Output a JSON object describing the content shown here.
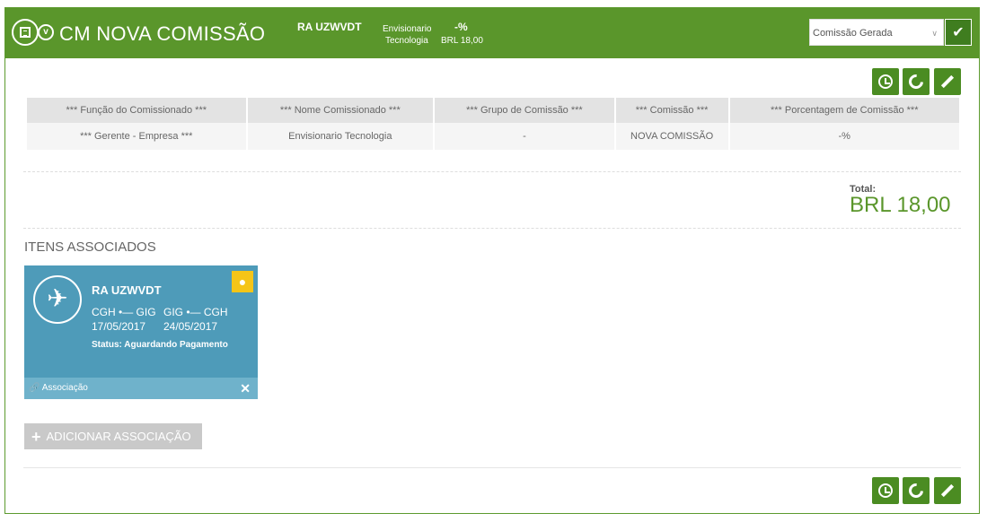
{
  "header": {
    "title": "CM NOVA COMISSÃO",
    "code": "RA UZWVDT",
    "name_line1": "Envisionario",
    "name_line2": "Tecnologia",
    "percent": "-%",
    "amount": "BRL 18,00",
    "status_selected": "Comissão Gerada",
    "colors": {
      "header_bg": "#5a962b",
      "button_bg": "#4b8c22"
    }
  },
  "table": {
    "headers": [
      "*** Função do Comissionado ***",
      "*** Nome Comissionado ***",
      "*** Grupo de Comissão ***",
      "*** Comissão ***",
      "*** Porcentagem de Comissão ***"
    ],
    "rows": [
      [
        "*** Gerente - Empresa ***",
        "Envisionario Tecnologia",
        "-",
        "NOVA COMISSÃO",
        "-%"
      ]
    ]
  },
  "total": {
    "label": "Total:",
    "value": "BRL 18,00"
  },
  "associated": {
    "title": "ITENS ASSOCIADOS",
    "card": {
      "code": "RA UZWVDT",
      "route_out": "CGH •— GIG",
      "date_out": "17/05/2017",
      "route_back": "GIG •— CGH",
      "date_back": "24/05/2017",
      "status": "Status: Aguardando Pagamento",
      "footer": "Associação",
      "icon": "airplane-icon",
      "badge_icon": "money-bag-icon"
    },
    "add_button": "ADICIONAR ASSOCIAÇÃO"
  }
}
